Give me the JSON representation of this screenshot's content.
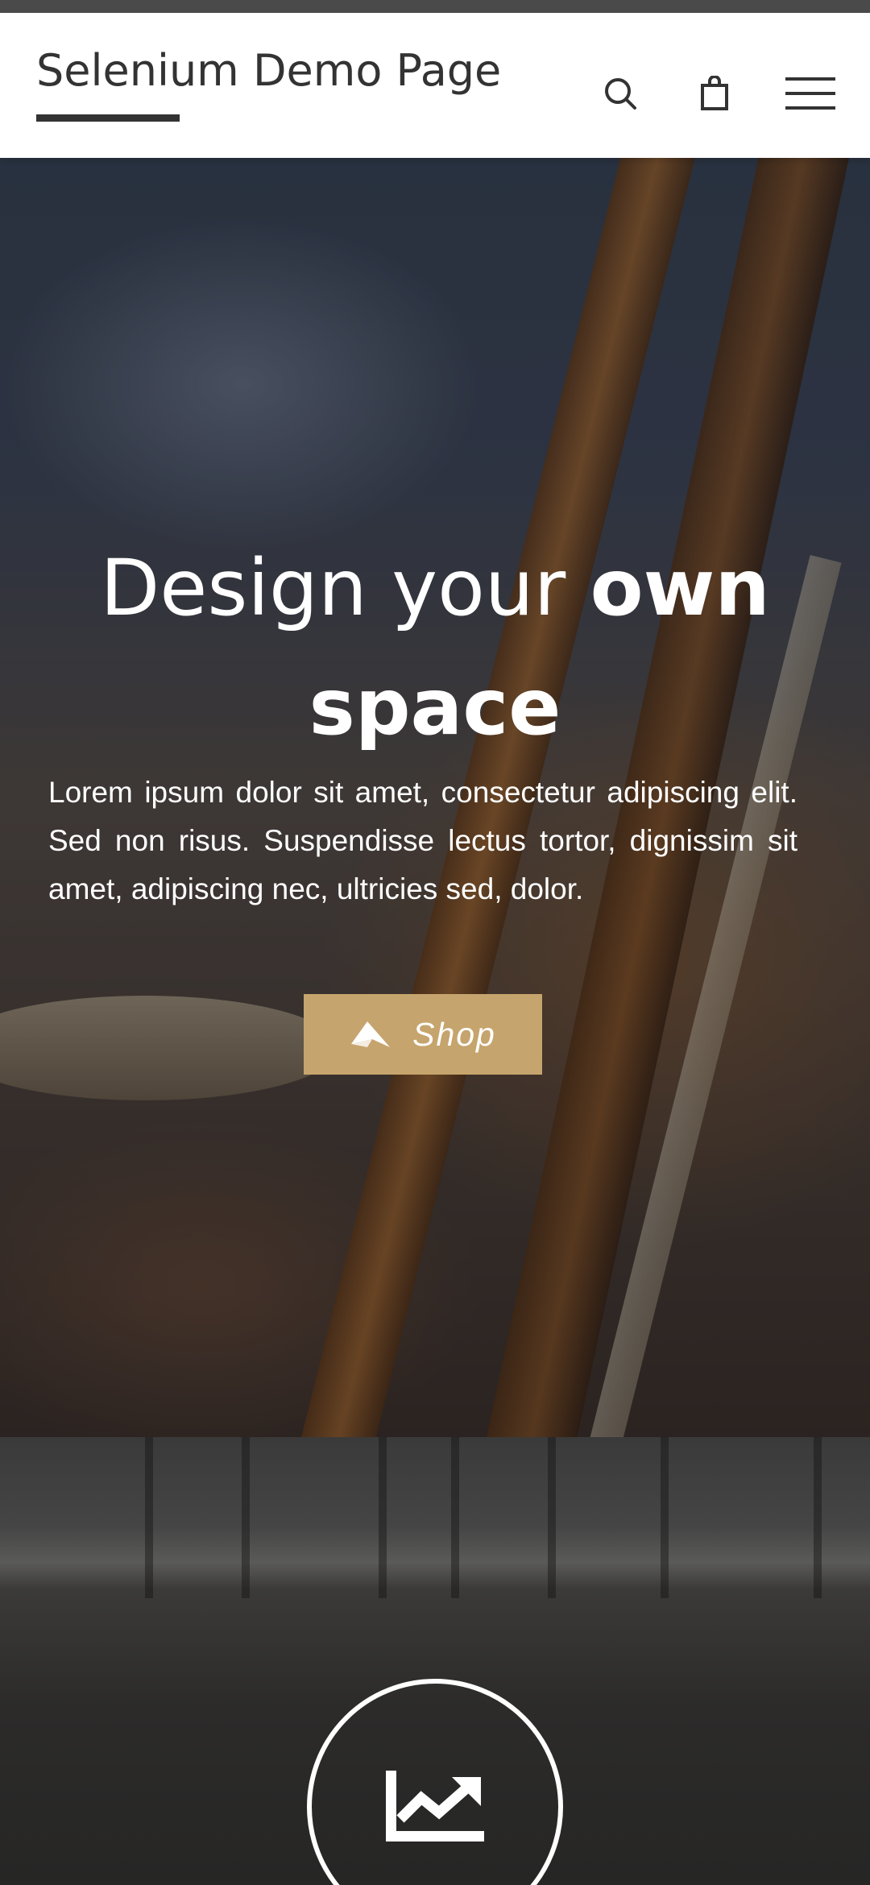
{
  "header": {
    "site_title": "Selenium Demo Page",
    "icons": [
      "search-icon",
      "shopping-bag-icon",
      "hamburger-menu-icon"
    ]
  },
  "hero": {
    "heading_regular": "Design your ",
    "heading_bold": "own space",
    "body": "Lorem ipsum dolor sit amet, consectetur adipiscing elit. Sed non risus. Suspendisse lectus tortor, dignissim sit amet, adipiscing nec, ultricies sed, dolor.",
    "shop_button_label": "Shop",
    "shop_button_icon": "paper-plane-icon"
  },
  "features": {
    "icon": "line-chart-icon"
  },
  "colors": {
    "accent": "#c6a46d",
    "header_bg": "#ffffff",
    "text_dark": "#333333"
  }
}
